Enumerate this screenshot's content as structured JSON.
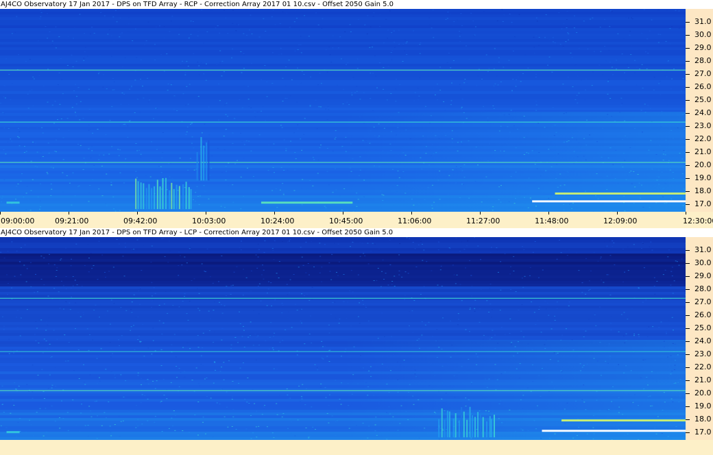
{
  "chart_data": [
    {
      "type": "heatmap",
      "title": "AJ4CO Observatory 17 Jan 2017  -  DPS on TFD Array  -  RCP  -  Correction Array 2017 01 10.csv  -  Offset 2050  Gain 5.0",
      "x_tick_labels": [
        "09:00:00",
        "09:21:00",
        "09:42:00",
        "10:03:00",
        "10:24:00",
        "10:45:00",
        "11:06:00",
        "11:27:00",
        "11:48:00",
        "12:09:00",
        "12:30:00"
      ],
      "y_tick_labels": [
        "31.0",
        "30.0",
        "29.0",
        "28.0",
        "27.0",
        "26.0",
        "25.0",
        "24.0",
        "23.0",
        "22.0",
        "21.0",
        "20.0",
        "19.0",
        "18.0",
        "17.0"
      ],
      "xlim": [
        "09:00:00",
        "12:30:00"
      ],
      "ylim": [
        16.4,
        32.0
      ],
      "colormap": [
        "#0a1f8c",
        "#1040c8",
        "#1a63e6",
        "#20a0f0",
        "#40e0d0",
        "#c8f060",
        "#ffffff"
      ],
      "features": [
        {
          "kind": "band",
          "freq": 27.3,
          "start": "09:00:00",
          "end": "12:30:00",
          "intensity": 0.55
        },
        {
          "kind": "band",
          "freq": 23.3,
          "start": "09:00:00",
          "end": "12:30:00",
          "intensity": 0.5
        },
        {
          "kind": "band",
          "freq": 20.2,
          "start": "09:00:00",
          "end": "12:30:00",
          "intensity": 0.55
        },
        {
          "kind": "burst",
          "freq_low": 16.6,
          "freq_high": 19.0,
          "start": "09:41:00",
          "end": "09:59:00",
          "intensity": 0.75
        },
        {
          "kind": "burst",
          "freq_low": 18.8,
          "freq_high": 22.2,
          "start": "10:00:00",
          "end": "10:04:00",
          "intensity": 0.55
        },
        {
          "kind": "trace",
          "freq": 17.1,
          "start": "10:20:00",
          "end": "10:48:00",
          "intensity": 0.7
        },
        {
          "kind": "trace",
          "freq": 17.2,
          "start": "11:43:00",
          "end": "12:30:00",
          "intensity": 1.0
        },
        {
          "kind": "trace",
          "freq": 17.8,
          "start": "11:50:00",
          "end": "12:30:00",
          "intensity": 0.85
        },
        {
          "kind": "trace",
          "freq": 17.1,
          "start": "09:02:00",
          "end": "09:06:00",
          "intensity": 0.6
        }
      ]
    },
    {
      "type": "heatmap",
      "title": "AJ4CO Observatory 17 Jan 2017  -  DPS on TFD Array  -  LCP  -  Correction Array 2017 01 10.csv  -  Offset 2050  Gain 5.0",
      "x_tick_labels": [],
      "y_tick_labels": [
        "31.0",
        "30.0",
        "29.0",
        "28.0",
        "27.0",
        "26.0",
        "25.0",
        "24.0",
        "23.0",
        "22.0",
        "21.0",
        "20.0",
        "19.0",
        "18.0",
        "17.0"
      ],
      "xlim": [
        "09:00:00",
        "12:30:00"
      ],
      "ylim": [
        16.4,
        32.0
      ],
      "colormap": [
        "#08126e",
        "#0f35b4",
        "#1a5ae0",
        "#20a0f0",
        "#40e0d0",
        "#c8f060",
        "#ffffff"
      ],
      "features": [
        {
          "kind": "band",
          "freq": 27.3,
          "start": "09:00:00",
          "end": "12:30:00",
          "intensity": 0.5
        },
        {
          "kind": "band",
          "freq": 23.2,
          "start": "09:00:00",
          "end": "12:30:00",
          "intensity": 0.45
        },
        {
          "kind": "band",
          "freq": 20.2,
          "start": "09:00:00",
          "end": "12:30:00",
          "intensity": 0.55
        },
        {
          "kind": "burst",
          "freq_low": 16.6,
          "freq_high": 19.0,
          "start": "11:14:00",
          "end": "11:32:00",
          "intensity": 0.7
        },
        {
          "kind": "trace",
          "freq": 17.1,
          "start": "11:46:00",
          "end": "12:30:00",
          "intensity": 1.0
        },
        {
          "kind": "trace",
          "freq": 17.9,
          "start": "11:52:00",
          "end": "12:30:00",
          "intensity": 0.85
        },
        {
          "kind": "trace",
          "freq": 17.0,
          "start": "09:02:00",
          "end": "09:06:00",
          "intensity": 0.6
        }
      ]
    }
  ]
}
